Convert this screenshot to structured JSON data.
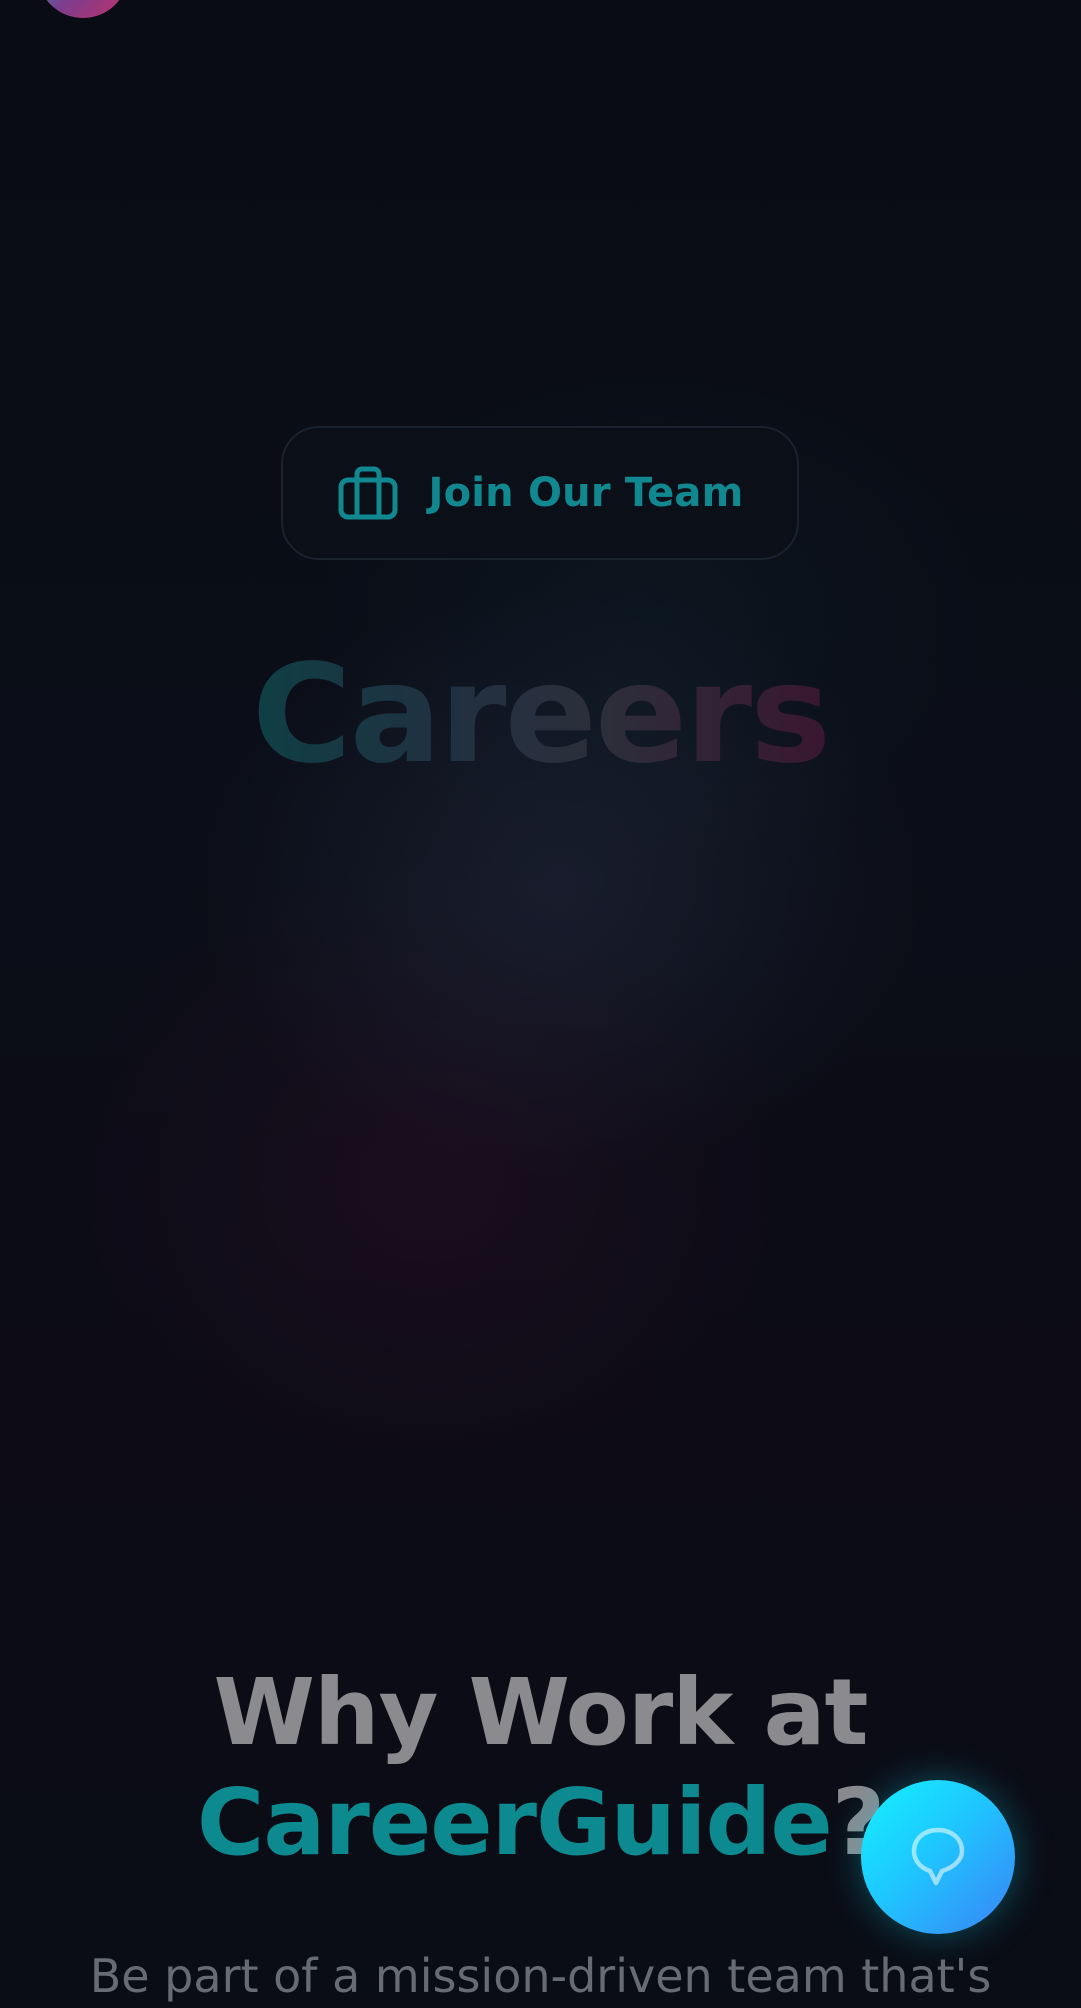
{
  "header": {
    "logo_icon": "brand-avatar"
  },
  "hero": {
    "pill_label": "Join Our Team",
    "pill_icon": "briefcase-icon",
    "title": "Careers"
  },
  "why": {
    "title_line1": "Why Work at",
    "brand": "CareerGuide",
    "punctuation": "?",
    "subtitle": "Be part of a mission-driven team that's"
  },
  "chat_fab": {
    "icon": "chat-bubble-icon"
  },
  "colors": {
    "accent_teal": "#0d8a8f",
    "background": "#0a0d16",
    "heading_gray": "#8a8a8f",
    "fab_start": "#14f2ff",
    "fab_end": "#3b82f6"
  }
}
